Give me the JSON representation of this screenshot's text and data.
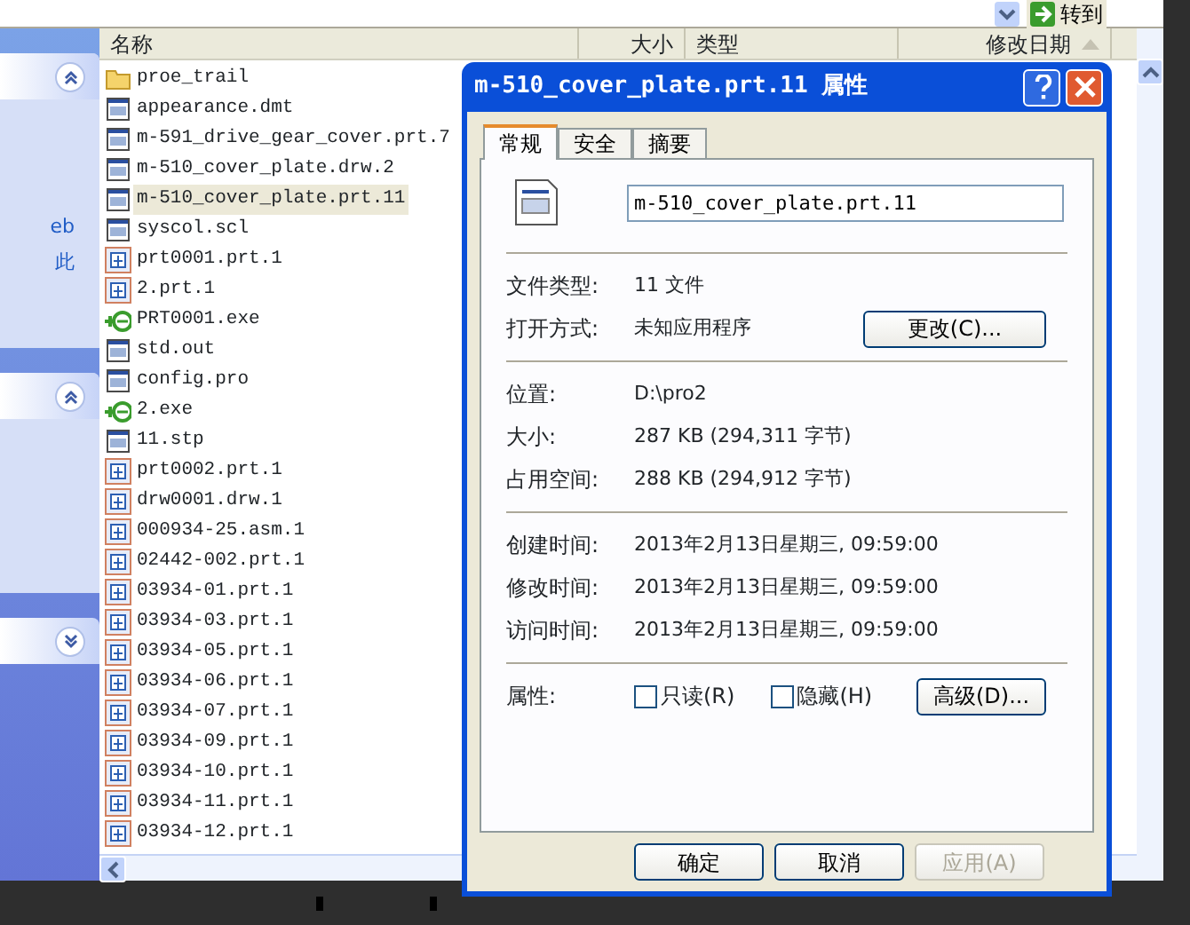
{
  "address_bar": {
    "go_button": "转到"
  },
  "task_pane": {
    "sections": [
      {
        "expanded": true,
        "texts": [
          "eb",
          "此"
        ]
      },
      {
        "expanded": true
      },
      {
        "expanded": false
      }
    ]
  },
  "file_list": {
    "columns": [
      {
        "label": "名称",
        "sorted": false
      },
      {
        "label": "大小",
        "sorted": false
      },
      {
        "label": "类型",
        "sorted": false
      },
      {
        "label": "修改日期",
        "sorted": true
      }
    ],
    "files": [
      {
        "name": "proe_trail",
        "kind": "folder",
        "selected": false
      },
      {
        "name": "appearance.dmt",
        "kind": "document",
        "selected": false
      },
      {
        "name": "m-591_drive_gear_cover.prt.7",
        "kind": "document",
        "selected": false
      },
      {
        "name": "m-510_cover_plate.drw.2",
        "kind": "document",
        "selected": false
      },
      {
        "name": "m-510_cover_plate.prt.11",
        "kind": "document",
        "selected": true
      },
      {
        "name": "syscol.scl",
        "kind": "document",
        "selected": false
      },
      {
        "name": "prt0001.prt.1",
        "kind": "part",
        "selected": false
      },
      {
        "name": "2.prt.1",
        "kind": "part",
        "selected": false
      },
      {
        "name": "PRT0001.exe",
        "kind": "program",
        "selected": false
      },
      {
        "name": "std.out",
        "kind": "document",
        "selected": false
      },
      {
        "name": "config.pro",
        "kind": "document",
        "selected": false
      },
      {
        "name": "2.exe",
        "kind": "program",
        "selected": false
      },
      {
        "name": "11.stp",
        "kind": "document",
        "selected": false
      },
      {
        "name": "prt0002.prt.1",
        "kind": "part",
        "selected": false
      },
      {
        "name": "drw0001.drw.1",
        "kind": "part",
        "selected": false
      },
      {
        "name": "000934-25.asm.1",
        "kind": "part",
        "selected": false
      },
      {
        "name": "02442-002.prt.1",
        "kind": "part",
        "selected": false
      },
      {
        "name": "03934-01.prt.1",
        "kind": "part",
        "selected": false
      },
      {
        "name": "03934-03.prt.1",
        "kind": "part",
        "selected": false
      },
      {
        "name": "03934-05.prt.1",
        "kind": "part",
        "selected": false
      },
      {
        "name": "03934-06.prt.1",
        "kind": "part",
        "selected": false
      },
      {
        "name": "03934-07.prt.1",
        "kind": "part",
        "selected": false
      },
      {
        "name": "03934-09.prt.1",
        "kind": "part",
        "selected": false
      },
      {
        "name": "03934-10.prt.1",
        "kind": "part",
        "selected": false
      },
      {
        "name": "03934-11.prt.1",
        "kind": "part",
        "selected": false
      },
      {
        "name": "03934-12.prt.1",
        "kind": "part",
        "selected": false
      }
    ]
  },
  "dialog": {
    "title": "m-510_cover_plate.prt.11 属性",
    "tabs": [
      {
        "label": "常规",
        "selected": true
      },
      {
        "label": "安全",
        "selected": false
      },
      {
        "label": "摘要",
        "selected": false
      }
    ],
    "file_name": "m-510_cover_plate.prt.11",
    "groups": [
      [
        {
          "label": "文件类型:",
          "value": "11 文件"
        },
        {
          "label": "打开方式:",
          "value": "未知应用程序",
          "button": "更改(C)..."
        }
      ],
      [
        {
          "label": "位置:",
          "value": "D:\\pro2"
        },
        {
          "label": "大小:",
          "value": "287 KB (294,311 字节)"
        },
        {
          "label": "占用空间:",
          "value": "288 KB (294,912 字节)"
        }
      ],
      [
        {
          "label": "创建时间:",
          "value": "2013年2月13日星期三, 09:59:00"
        },
        {
          "label": "修改时间:",
          "value": "2013年2月13日星期三, 09:59:00"
        },
        {
          "label": "访问时间:",
          "value": "2013年2月13日星期三, 09:59:00"
        }
      ]
    ],
    "attributes": {
      "label": "属性:",
      "options": [
        {
          "label": "只读(R)",
          "checked": false
        },
        {
          "label": "隐藏(H)",
          "checked": false
        }
      ],
      "advanced_button": "高级(D)..."
    },
    "buttons": [
      {
        "label": "确定",
        "disabled": false
      },
      {
        "label": "取消",
        "disabled": false
      },
      {
        "label": "应用(A)",
        "disabled": true
      }
    ]
  }
}
